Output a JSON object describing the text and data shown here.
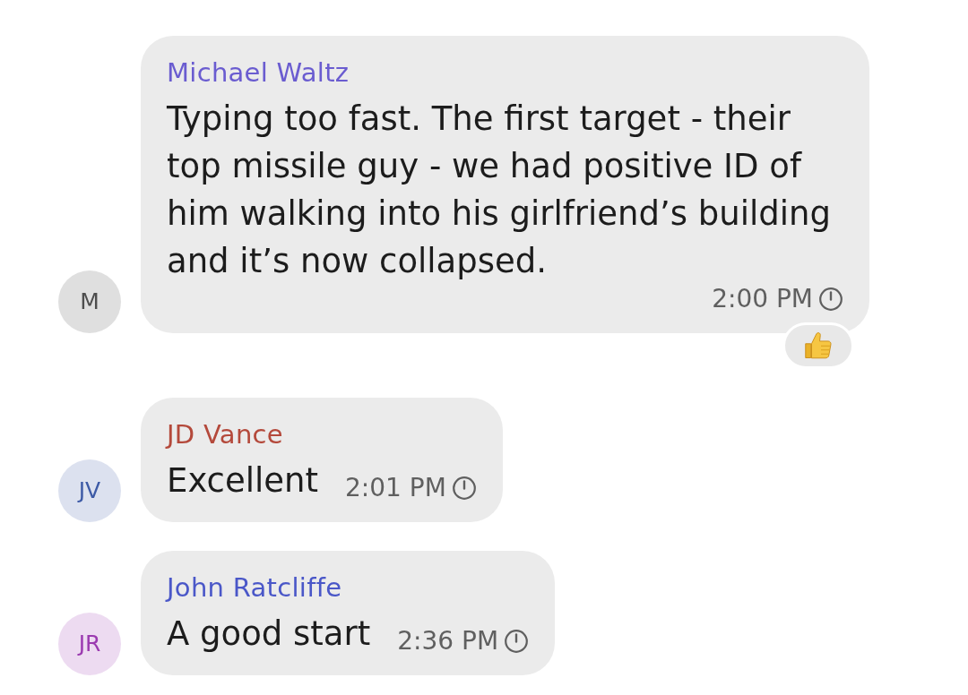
{
  "messages": [
    {
      "avatar": {
        "initials": "M",
        "color": "#4d4d4d"
      },
      "sender": {
        "name": "Michael Waltz",
        "color": "#6a5cd0"
      },
      "text": "Typing too fast. The first target - their top missile guy - we had positive ID of him walking into his girlfriend’s building and it’s now collapsed.",
      "time": "2:00 PM",
      "reacted": true
    },
    {
      "avatar": {
        "initials": "JV",
        "color": "#3d5aa6"
      },
      "sender": {
        "name": "JD Vance",
        "color": "#b4493b"
      },
      "text": "Excellent",
      "time": "2:01 PM",
      "reacted": false
    },
    {
      "avatar": {
        "initials": "JR",
        "color": "#9b3ab0"
      },
      "sender": {
        "name": "John Ratcliffe",
        "color": "#4a57c8"
      },
      "text": "A good start",
      "time": "2:36 PM",
      "reacted": false
    }
  ]
}
